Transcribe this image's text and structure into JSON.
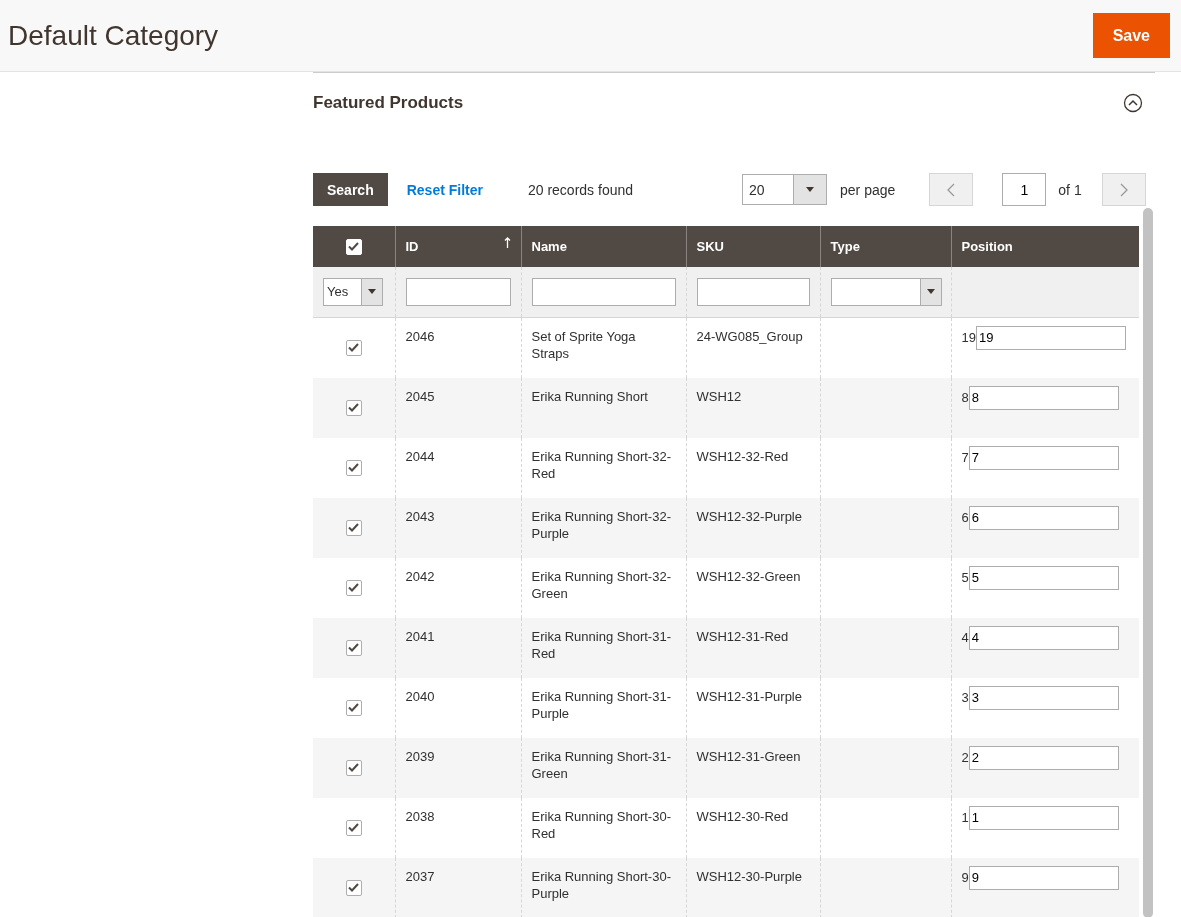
{
  "header": {
    "title": "Default Category",
    "save_button": "Save"
  },
  "section": {
    "title": "Featured Products",
    "expanded": true
  },
  "toolbar": {
    "search_button": "Search",
    "reset_link": "Reset Filter",
    "records": "20 records found",
    "per_page_value": "20",
    "per_page_label": "per page",
    "page_value": "1",
    "page_total": "of 1"
  },
  "table": {
    "header_checkbox_checked": true,
    "columns": [
      {
        "label": "ID",
        "sorted": true
      },
      {
        "label": "Name",
        "sorted": false
      },
      {
        "label": "SKU",
        "sorted": false
      },
      {
        "label": "Type",
        "sorted": false
      },
      {
        "label": "Position",
        "sorted": false
      }
    ],
    "filters": {
      "in_category": "Yes"
    },
    "rows": [
      {
        "checked": true,
        "id": "2046",
        "name": "Set of Sprite Yoga Straps",
        "sku": "24-WG085_Group",
        "position_label": "19",
        "position_value": "19"
      },
      {
        "checked": true,
        "id": "2045",
        "name": "Erika Running Short",
        "sku": "WSH12",
        "position_label": "8",
        "position_value": "8"
      },
      {
        "checked": true,
        "id": "2044",
        "name": "Erika Running Short-32-Red",
        "sku": "WSH12-32-Red",
        "position_label": "7",
        "position_value": "7"
      },
      {
        "checked": true,
        "id": "2043",
        "name": "Erika Running Short-32-Purple",
        "sku": "WSH12-32-Purple",
        "position_label": "6",
        "position_value": "6"
      },
      {
        "checked": true,
        "id": "2042",
        "name": "Erika Running Short-32-Green",
        "sku": "WSH12-32-Green",
        "position_label": "5",
        "position_value": "5"
      },
      {
        "checked": true,
        "id": "2041",
        "name": "Erika Running Short-31-Red",
        "sku": "WSH12-31-Red",
        "position_label": "4",
        "position_value": "4"
      },
      {
        "checked": true,
        "id": "2040",
        "name": "Erika Running Short-31-Purple",
        "sku": "WSH12-31-Purple",
        "position_label": "3",
        "position_value": "3"
      },
      {
        "checked": true,
        "id": "2039",
        "name": "Erika Running Short-31-Green",
        "sku": "WSH12-31-Green",
        "position_label": "2",
        "position_value": "2"
      },
      {
        "checked": true,
        "id": "2038",
        "name": "Erika Running Short-30-Red",
        "sku": "WSH12-30-Red",
        "position_label": "1",
        "position_value": "1"
      },
      {
        "checked": true,
        "id": "2037",
        "name": "Erika Running Short-30-Purple",
        "sku": "WSH12-30-Purple",
        "position_label": "9",
        "position_value": "9"
      }
    ]
  }
}
